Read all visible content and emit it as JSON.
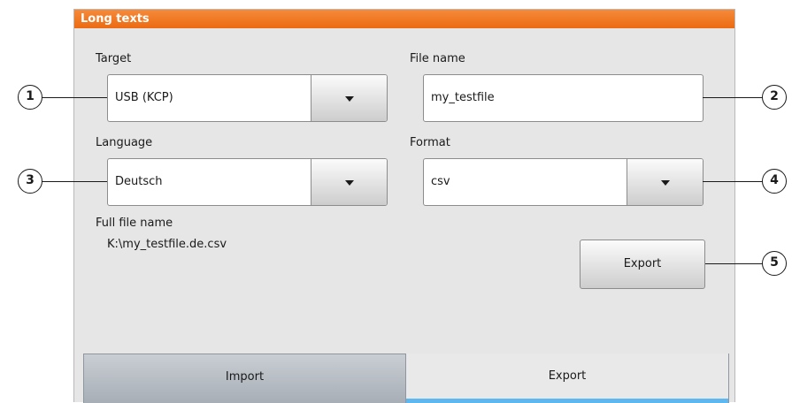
{
  "window": {
    "title": "Long texts"
  },
  "fields": {
    "target": {
      "label": "Target",
      "value": "USB (KCP)"
    },
    "file_name": {
      "label": "File name",
      "value": "my_testfile"
    },
    "language": {
      "label": "Language",
      "value": "Deutsch"
    },
    "format": {
      "label": "Format",
      "value": "csv"
    },
    "full_file_name": {
      "label": "Full file name",
      "value": "K:\\my_testfile.de.csv"
    }
  },
  "buttons": {
    "export": "Export"
  },
  "tabs": [
    {
      "label": "Import",
      "active": false
    },
    {
      "label": "Export",
      "active": true
    }
  ],
  "callouts": [
    "1",
    "2",
    "3",
    "4",
    "5"
  ],
  "colors": {
    "title_bar": "#ec6b12",
    "panel_bg": "#e6e6e6",
    "active_tab_indicator": "#5fb7ef"
  },
  "icons": {
    "dropdown": "chevron-down-icon"
  }
}
